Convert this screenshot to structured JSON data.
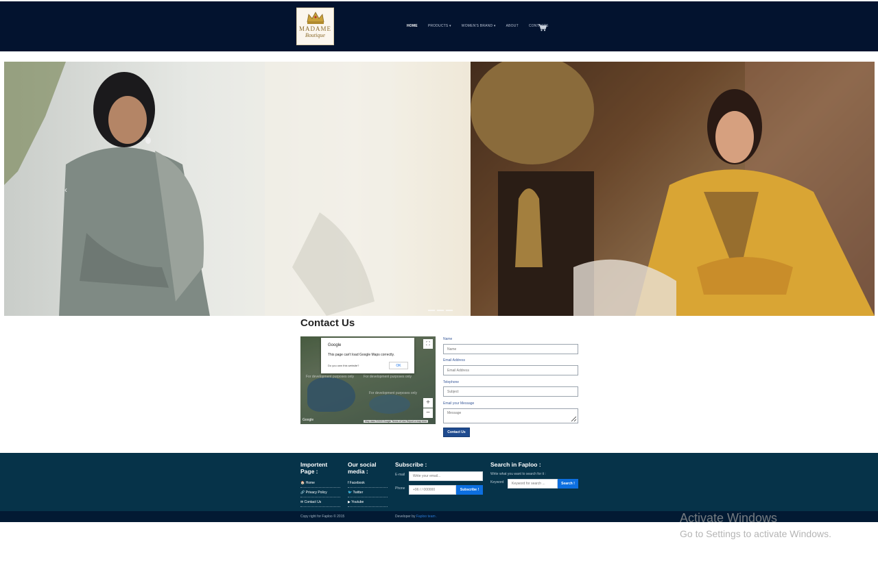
{
  "logo": {
    "line1": "MADAME",
    "line2": "Boutique"
  },
  "nav": {
    "items": [
      {
        "label": "HOME",
        "active": true
      },
      {
        "label": "PRODUCTS ▾",
        "active": false
      },
      {
        "label": "WOMEN'S BRAND ▾",
        "active": false
      },
      {
        "label": "ABOUT",
        "active": false
      },
      {
        "label": "CONTACTS",
        "active": false
      }
    ],
    "cart_icon": "cart-icon"
  },
  "hero": {
    "prev_glyph": "‹"
  },
  "contact": {
    "title": "Contact Us",
    "map": {
      "dialog_title": "Google",
      "dialog_message": "This page can't load Google Maps correctly.",
      "dialog_question": "Do you own this website?",
      "dialog_ok": "OK",
      "dev_text": "For development purposes only",
      "brand": "Google",
      "attribution": "Map data ©2020 Google  Terms of Use  Report a map error",
      "zoom_in": "+",
      "zoom_out": "−",
      "fullscreen": "⛶"
    },
    "form": {
      "name_label": "Name",
      "name_placeholder": "Name",
      "email_label": "Email Address",
      "email_placeholder": "Email Address",
      "phone_label": "Telephone",
      "phone_placeholder": "Subject",
      "message_label": "Email your Message",
      "message_placeholder": "Message",
      "submit": "Contact Us"
    }
  },
  "footer": {
    "important": {
      "heading": "Importent Page :",
      "links": [
        "🏠 Home",
        "🔗 Privacy Policy",
        "✉ Contact Us"
      ]
    },
    "social": {
      "heading": "Our social media :",
      "links": [
        "f Facebook",
        "🐦 Twitter",
        "▶ Youtube"
      ]
    },
    "subscribe": {
      "heading": "Subscribe :",
      "email_label": "E-mail",
      "email_placeholder": "Write your email...",
      "phone_label": "Phone",
      "phone_placeholder": "+96 / / 000000",
      "button": "Subscribe !"
    },
    "search": {
      "heading": "Search in Faploo :",
      "hint": "Write what you want to search for it :",
      "keyword_label": "Keyword",
      "placeholder": "Keyword for search ...",
      "button": "Search !"
    },
    "copyright": "Copy right for Faploo © 2015",
    "developer_prefix": "Developer by",
    "developer_link": "Faploo team ."
  },
  "watermark": {
    "line1": "Activate Windows",
    "line2": "Go to Settings to activate Windows."
  },
  "colors": {
    "header_bg": "#03132f",
    "footer_bg": "#063349",
    "footer_bottom_bg": "#021a33",
    "accent_blue": "#0d6fe0",
    "contact_btn": "#1f4b8f"
  }
}
